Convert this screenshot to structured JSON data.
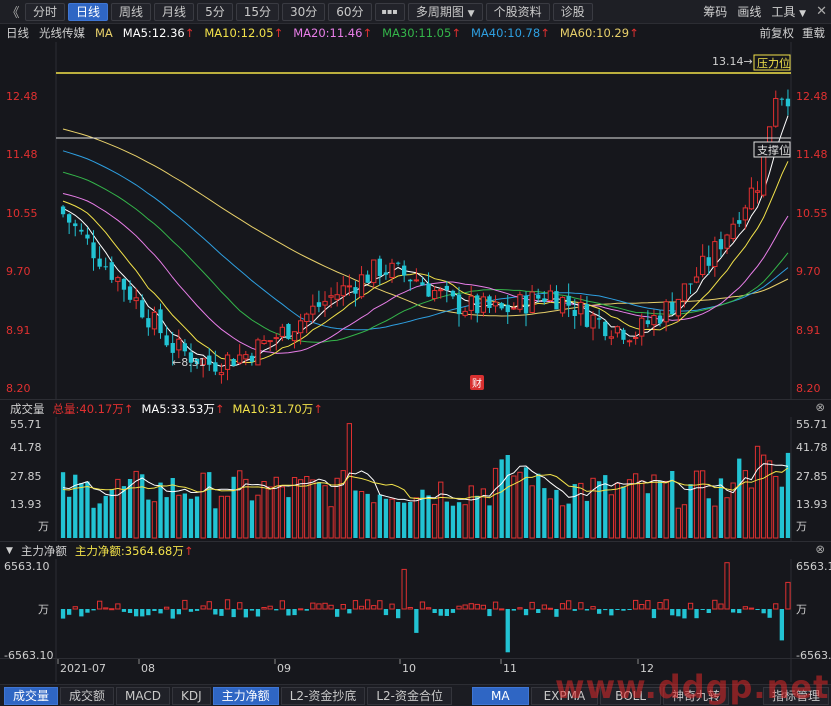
{
  "toolbar": {
    "back_glyph": "《",
    "tabs": [
      {
        "label": "分时",
        "active": false
      },
      {
        "label": "日线",
        "active": true
      },
      {
        "label": "周线",
        "active": false
      },
      {
        "label": "月线",
        "active": false
      },
      {
        "label": "5分",
        "active": false
      },
      {
        "label": "15分",
        "active": false
      },
      {
        "label": "30分",
        "active": false
      },
      {
        "label": "60分",
        "active": false
      }
    ],
    "more_label": "▪▪▪",
    "multi_period_label": "多周期图",
    "stock_info_label": "个股资料",
    "diagnose_label": "诊股",
    "right": {
      "chips_label": "筹码",
      "draw_label": "画线",
      "tools_label": "工具",
      "close_glyph": "✕"
    }
  },
  "ma_header": {
    "period": "日线",
    "stock_name": "光线传媒",
    "ma_label": "MA",
    "ma5": "MA5:12.36",
    "ma10": "MA10:12.05",
    "ma20": "MA20:11.46",
    "ma30": "MA30:11.05",
    "ma40": "MA40:10.78",
    "ma60": "MA60:10.29",
    "up_arrow": "↑",
    "forward_adjust": "前复权",
    "overlay": "重载"
  },
  "colors": {
    "ma5": "#ffffff",
    "ma10": "#f2e24a",
    "ma20": "#e87ee8",
    "ma30": "#34b54a",
    "ma40": "#2e9fe0",
    "ma60": "#e8d06a",
    "up": "#e03030",
    "down": "#22c3d3"
  },
  "price_axis": {
    "ticks": [
      "12.48",
      "11.48",
      "10.55",
      "9.70",
      "8.91",
      "8.20"
    ]
  },
  "annotations": {
    "high_label": "13.14",
    "low_label": "8.51",
    "resistance_label": "压力位",
    "support_label": "支撑位",
    "finance_badge": "财"
  },
  "volume_header": {
    "title": "成交量",
    "total": "总量:40.17万",
    "ma5": "MA5:33.53万",
    "ma10": "MA10:31.70万",
    "up_arrow": "↑",
    "close_glyph": "⊗"
  },
  "volume_axis": {
    "ticks": [
      "55.71",
      "41.78",
      "27.85",
      "13.93",
      "万"
    ]
  },
  "money_header": {
    "toggle_glyph": "▼",
    "title": "主力净额",
    "value": "主力净额:3564.68万",
    "up_arrow": "↑",
    "close_glyph": "⊗"
  },
  "money_axis": {
    "ticks": [
      "6563.10",
      "万",
      "-6563.10"
    ]
  },
  "date_axis": {
    "labels": [
      "2021-07",
      "08",
      "09",
      "10",
      "11",
      "12"
    ]
  },
  "bottom_tabs": {
    "left": [
      {
        "label": "成交量",
        "active": true
      },
      {
        "label": "成交额",
        "active": false
      },
      {
        "label": "MACD",
        "active": false
      },
      {
        "label": "KDJ",
        "active": false
      },
      {
        "label": "主力净额",
        "active": true
      },
      {
        "label": "L2-资金抄底",
        "active": false
      },
      {
        "label": "L2-资金合位",
        "active": false
      }
    ],
    "right": [
      {
        "label": "MA",
        "active": true
      },
      {
        "label": "EXPMA",
        "active": false
      },
      {
        "label": "BOLL",
        "active": false
      },
      {
        "label": "神奇九转",
        "active": false
      }
    ],
    "manager_label": "指标管理"
  },
  "watermark": "www.ddgp.net",
  "chart_data": {
    "type": "candlestick",
    "candle_count": 120,
    "price_range": [
      8.2,
      12.95
    ],
    "high_marker": 13.14,
    "low_marker": 8.51,
    "resistance": 13.14,
    "support": 11.74,
    "ma_last": {
      "ma5": 12.36,
      "ma10": 12.05,
      "ma20": 11.46,
      "ma30": 11.05,
      "ma40": 10.78,
      "ma60": 10.29
    },
    "volume_range_wan": [
      0,
      55.71
    ],
    "volume_last_wan": 40.17,
    "money_range_wan": [
      -6563.1,
      6563.1
    ],
    "money_last_wan": 3564.68
  }
}
